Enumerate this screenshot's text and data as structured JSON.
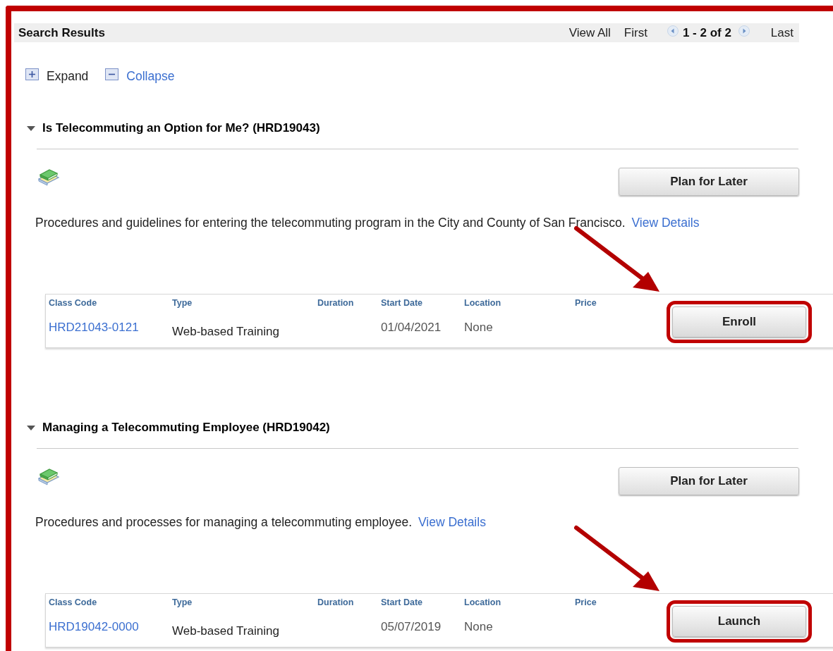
{
  "header": {
    "title": "Search Results",
    "view_all": "View All",
    "first": "First",
    "range": "1 - 2 of 2",
    "last": "Last"
  },
  "expand": "Expand",
  "collapse": "Collapse",
  "courses": [
    {
      "title": "Is Telecommuting an Option for Me? (HRD19043)",
      "expanded": true,
      "plan_button": "Plan for Later",
      "description": "Procedures and guidelines for entering the telecommuting program in the City and County of San Francisco.",
      "details_link": "View Details",
      "columns": [
        "Class Code",
        "Type",
        "Duration",
        "Start Date",
        "Location",
        "Price"
      ],
      "rows": [
        {
          "class_code": "HRD21043-0121",
          "type": "Web-based Training",
          "start_date": "01/04/2021",
          "location": "None",
          "action": "Enroll",
          "highlighted": true
        }
      ]
    },
    {
      "title": "Managing a Telecommuting Employee (HRD19042)",
      "expanded": true,
      "plan_button": "Plan for Later",
      "description": "Procedures and processes for managing a telecommuting employee.",
      "details_link": "View Details",
      "columns": [
        "Class Code",
        "Type",
        "Duration",
        "Start Date",
        "Location",
        "Price"
      ],
      "rows": [
        {
          "class_code": "HRD19042-0000",
          "type": "Web-based Training",
          "start_date": "05/07/2019",
          "location": "None",
          "action": "Launch",
          "highlighted": true
        }
      ]
    }
  ]
}
